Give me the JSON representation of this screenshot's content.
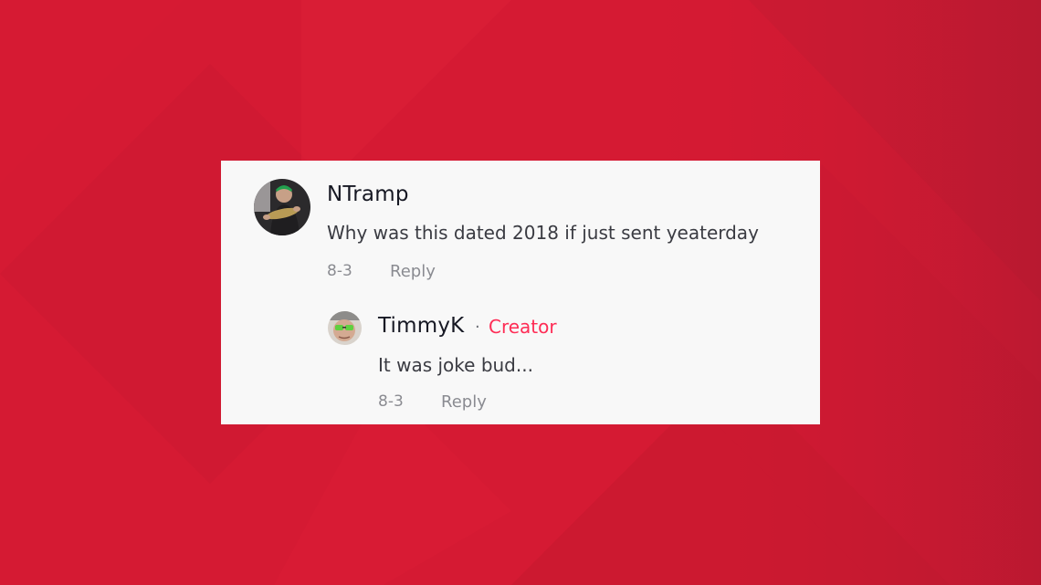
{
  "colors": {
    "background_red": "#d51a33",
    "card_bg": "#f8f8f8",
    "username": "#161823",
    "text": "#3a3b42",
    "muted": "#8a8b91",
    "creator_accent": "#fe2c55"
  },
  "comment": {
    "username": "NTramp",
    "text": "Why was this dated 2018 if just sent yeaterday",
    "date": "8-3",
    "reply_label": "Reply",
    "avatar_icon": "avatar-ntramp-icon"
  },
  "reply": {
    "username": "TimmyK",
    "separator": "·",
    "badge": "Creator",
    "text": "It was joke bud...",
    "date": "8-3",
    "reply_label": "Reply",
    "avatar_icon": "avatar-timmyk-icon"
  }
}
